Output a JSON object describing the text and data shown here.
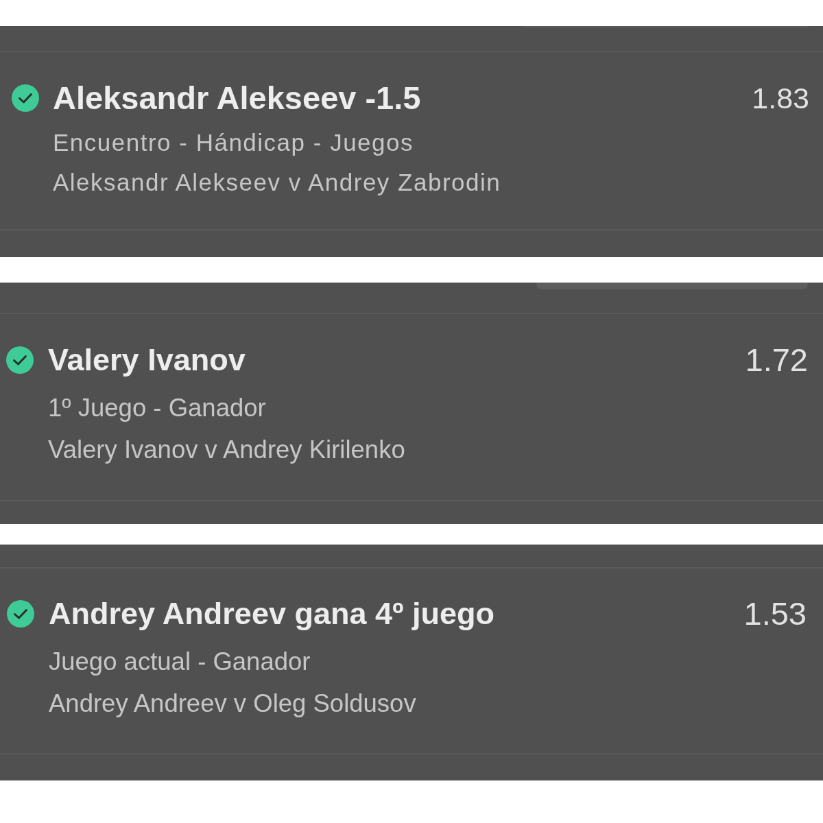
{
  "bets": [
    {
      "won": true,
      "selection": "Aleksandr Alekseev -1.5",
      "odds": "1.83",
      "market": "Encuentro - Hándicap - Juegos",
      "event": "Aleksandr Alekseev v Andrey Zabrodin"
    },
    {
      "won": true,
      "selection": "Valery Ivanov",
      "odds": "1.72",
      "market": "1º Juego - Ganador",
      "event": "Valery Ivanov v Andrey Kirilenko"
    },
    {
      "won": true,
      "selection": "Andrey Andreev gana 4º juego",
      "odds": "1.53",
      "market": "Juego actual - Ganador",
      "event": "Andrey Andreev v Oleg Soldusov"
    }
  ]
}
